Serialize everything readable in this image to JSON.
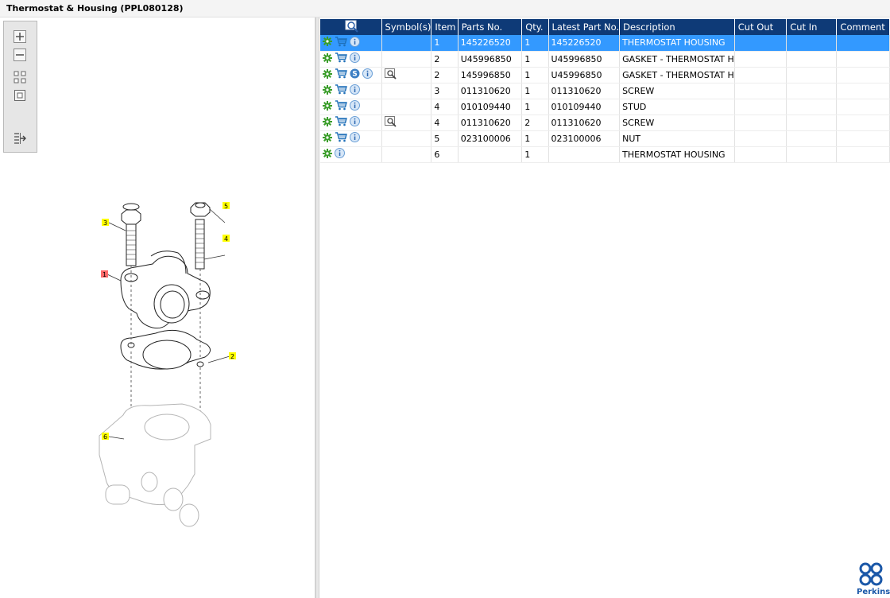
{
  "window": {
    "title": "Thermostat & Housing (PPL080128)"
  },
  "toolbar": {
    "items": [
      {
        "name": "zoom-in-icon"
      },
      {
        "name": "zoom-out-icon"
      },
      {
        "name": "fit-grid-icon"
      },
      {
        "name": "actual-size-icon"
      },
      {
        "name": "toggle-pane-icon"
      }
    ]
  },
  "diagram": {
    "callouts": [
      "1",
      "2",
      "3",
      "4",
      "5",
      "6"
    ],
    "highlight_color": "#ffff00",
    "selected_color": "#ff6a6a"
  },
  "table": {
    "headers": {
      "icons": "",
      "symbols": "Symbol(s)",
      "item": "Item",
      "parts_no": "Parts No.",
      "qty": "Qty.",
      "latest_part_no": "Latest Part No.",
      "description": "Description",
      "cut_out": "Cut Out",
      "cut_in": "Cut In",
      "comment": "Comment"
    },
    "rows": [
      {
        "selected": true,
        "icons": [
          "gear",
          "cart",
          "info"
        ],
        "symbol": "",
        "item": "1",
        "parts_no": "145226520",
        "qty": "1",
        "latest_part_no": "145226520",
        "description": "THERMOSTAT HOUSING",
        "cut_out": "",
        "cut_in": "",
        "comment": ""
      },
      {
        "selected": false,
        "icons": [
          "gear",
          "cart",
          "info"
        ],
        "symbol": "",
        "item": "2",
        "parts_no": "U45996850",
        "qty": "1",
        "latest_part_no": "U45996850",
        "description": "GASKET - THERMOSTAT H",
        "cut_out": "",
        "cut_in": "",
        "comment": ""
      },
      {
        "selected": false,
        "icons": [
          "gear",
          "cart",
          "s-badge",
          "info"
        ],
        "symbol": "magnify",
        "item": "2",
        "parts_no": "145996850",
        "qty": "1",
        "latest_part_no": "U45996850",
        "description": "GASKET - THERMOSTAT H",
        "cut_out": "",
        "cut_in": "",
        "comment": ""
      },
      {
        "selected": false,
        "icons": [
          "gear",
          "cart",
          "info"
        ],
        "symbol": "",
        "item": "3",
        "parts_no": "011310620",
        "qty": "1",
        "latest_part_no": "011310620",
        "description": "SCREW",
        "cut_out": "",
        "cut_in": "",
        "comment": ""
      },
      {
        "selected": false,
        "icons": [
          "gear",
          "cart",
          "info"
        ],
        "symbol": "",
        "item": "4",
        "parts_no": "010109440",
        "qty": "1",
        "latest_part_no": "010109440",
        "description": "STUD",
        "cut_out": "",
        "cut_in": "",
        "comment": ""
      },
      {
        "selected": false,
        "icons": [
          "gear",
          "cart",
          "info"
        ],
        "symbol": "magnify",
        "item": "4",
        "parts_no": "011310620",
        "qty": "2",
        "latest_part_no": "011310620",
        "description": "SCREW",
        "cut_out": "",
        "cut_in": "",
        "comment": ""
      },
      {
        "selected": false,
        "icons": [
          "gear",
          "cart",
          "info"
        ],
        "symbol": "",
        "item": "5",
        "parts_no": "023100006",
        "qty": "1",
        "latest_part_no": "023100006",
        "description": "NUT",
        "cut_out": "",
        "cut_in": "",
        "comment": ""
      },
      {
        "selected": false,
        "icons": [
          "gear",
          "info"
        ],
        "symbol": "",
        "item": "6",
        "parts_no": "",
        "qty": "1",
        "latest_part_no": "",
        "description": "THERMOSTAT HOUSING",
        "cut_out": "",
        "cut_in": "",
        "comment": ""
      }
    ]
  },
  "brand": {
    "name": "Perkins",
    "color": "#1b58a8"
  },
  "colors": {
    "header_bg": "#0e3a77",
    "selected_row": "#3399ff",
    "gear": "#3a9d2a",
    "cart": "#1e6fb8",
    "info": "#6a9fd6"
  }
}
